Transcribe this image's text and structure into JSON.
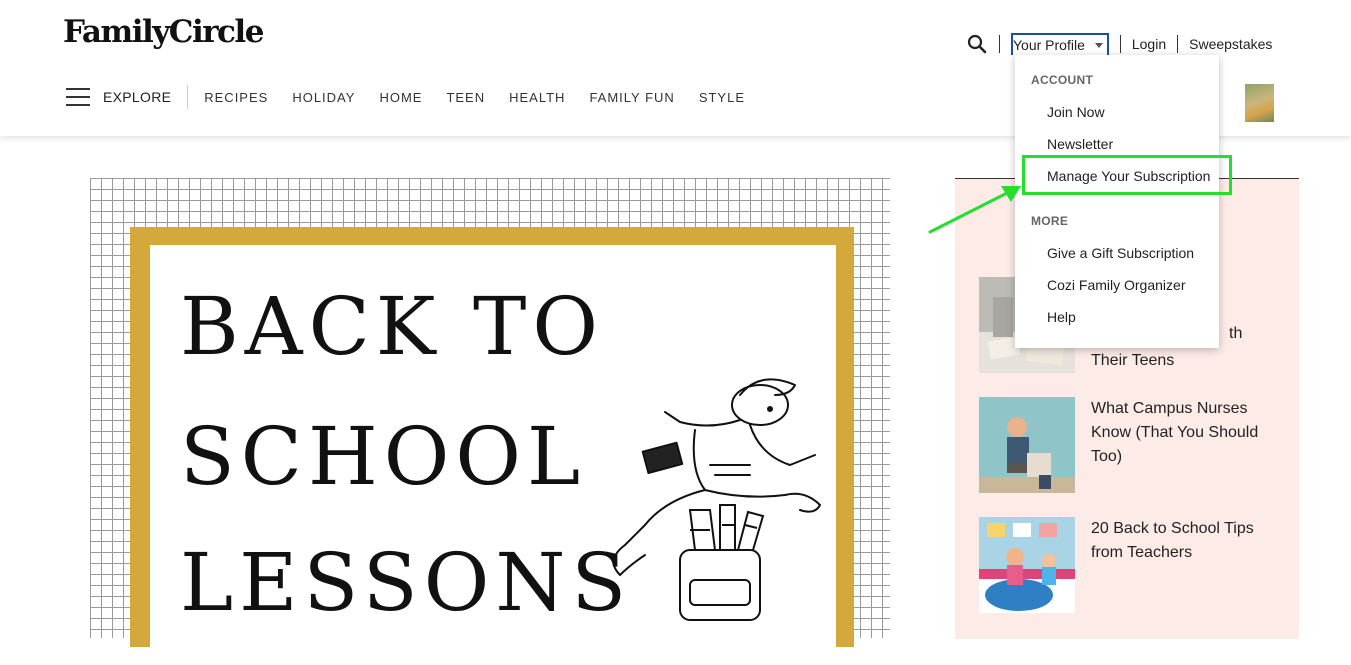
{
  "brand": {
    "logo": "FamilyCircle"
  },
  "top_links": {
    "profile": "Your Profile",
    "login": "Login",
    "sweepstakes": "Sweepstakes"
  },
  "nav": {
    "explore": "EXPLORE",
    "items": [
      "RECIPES",
      "HOLIDAY",
      "HOME",
      "TEEN",
      "HEALTH",
      "FAMILY FUN",
      "STYLE"
    ]
  },
  "dropdown": {
    "account_header": "ACCOUNT",
    "account_items": [
      "Join Now",
      "Newsletter",
      "Manage Your Subscription"
    ],
    "more_header": "MORE",
    "more_items": [
      "Give a Gift Subscription",
      "Cozi Family Organizer",
      "Help"
    ]
  },
  "hero": {
    "lines": [
      "BACK TO",
      "SCHOOL",
      "LESSONS"
    ]
  },
  "sidebar": {
    "stories": [
      {
        "title": "Their Teens",
        "partial": "th"
      },
      {
        "title": "What Campus Nurses Know (That You Should Too)"
      },
      {
        "title": "20 Back to School Tips from Teachers"
      }
    ]
  },
  "colors": {
    "highlight": "#22e02c",
    "profile_border": "#1a4fa0",
    "frame_gold": "#d4a93c",
    "sidebar_bg": "#fdebe8"
  },
  "icons": [
    "search-icon",
    "chevron-down-icon",
    "hamburger-menu-icon",
    "arrow-annotation-icon"
  ]
}
